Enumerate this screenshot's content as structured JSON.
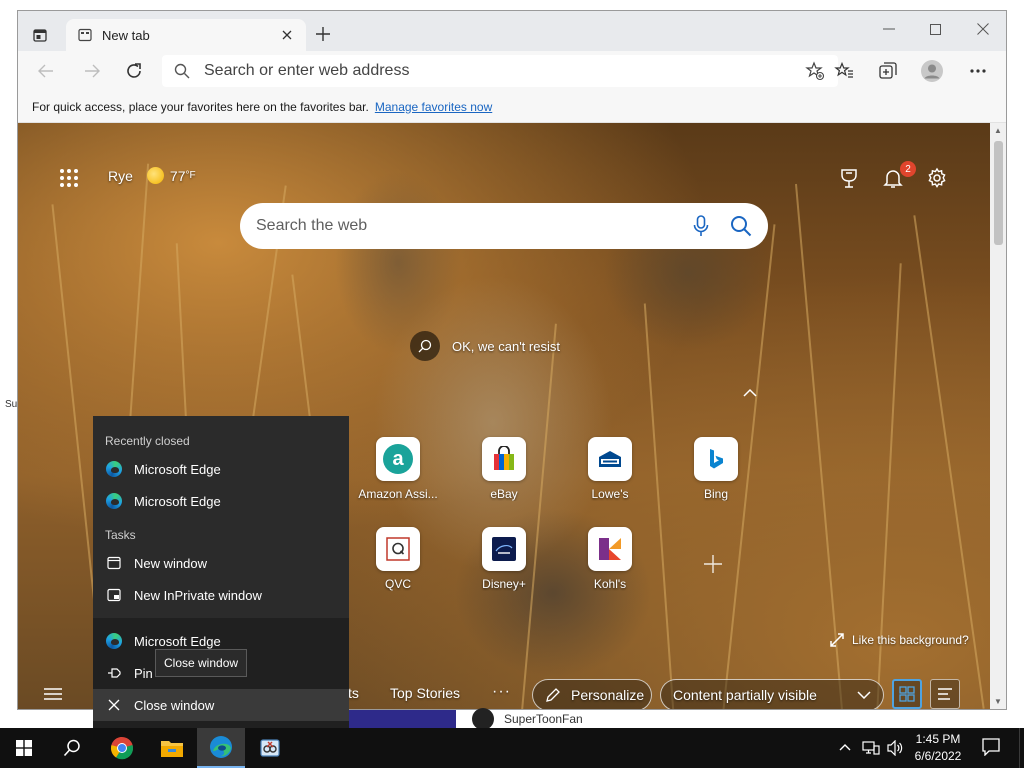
{
  "desktop": {
    "stray_text": "Su"
  },
  "browser": {
    "tab": {
      "title": "New tab"
    },
    "address_bar": {
      "placeholder": "Search or enter web address"
    },
    "favorites_bar": {
      "message": "For quick access, place your favorites here on the favorites bar.",
      "link": "Manage favorites now"
    }
  },
  "ntp": {
    "weather": {
      "location": "Rye",
      "temperature": "77",
      "unit": "°F"
    },
    "notifications_count": "2",
    "search": {
      "placeholder": "Search the web"
    },
    "photo_caption": "OK, we can't resist",
    "quick_links": [
      {
        "label": "Amazon Assi...",
        "icon": "amazon-icon",
        "color": "#1aa39a"
      },
      {
        "label": "eBay",
        "icon": "ebay-icon",
        "color": "#e53238"
      },
      {
        "label": "Lowe's",
        "icon": "lowes-icon",
        "color": "#004990"
      },
      {
        "label": "Bing",
        "icon": "bing-icon",
        "color": "#0a84d0"
      },
      {
        "label": "QVC",
        "icon": "qvc-icon",
        "color": "#c0392b"
      },
      {
        "label": "Disney+",
        "icon": "disney-plus-icon",
        "color": "#0c1b4d"
      },
      {
        "label": "Kohl's",
        "icon": "kohls-icon",
        "color": "#7b2f8a"
      }
    ],
    "like_background": "Like this background?",
    "feed": {
      "partial_tab": "ts",
      "top_stories": "Top Stories",
      "more": "···",
      "personalize": "Personalize",
      "content_visibility": "Content partially visible"
    },
    "feed_peek": {
      "author": "SuperToonFan"
    }
  },
  "jumplist": {
    "recently_closed_header": "Recently closed",
    "recently_closed": [
      "Microsoft Edge",
      "Microsoft Edge"
    ],
    "tasks_header": "Tasks",
    "tasks": [
      "New window",
      "New InPrivate window"
    ],
    "pinned": {
      "app": "Microsoft Edge",
      "pin": "Pin",
      "close": "Close window"
    },
    "tooltip": "Close window"
  },
  "taskbar": {
    "time": "1:45 PM",
    "date": "6/6/2022",
    "pinned": [
      "start-icon",
      "search-icon",
      "chrome-icon",
      "file-explorer-icon",
      "edge-icon",
      "snipping-tool-icon"
    ]
  },
  "colors": {
    "accent": "#1a66c2",
    "grid_view_border": "#4fa3e0",
    "badge": "#e0452d"
  }
}
